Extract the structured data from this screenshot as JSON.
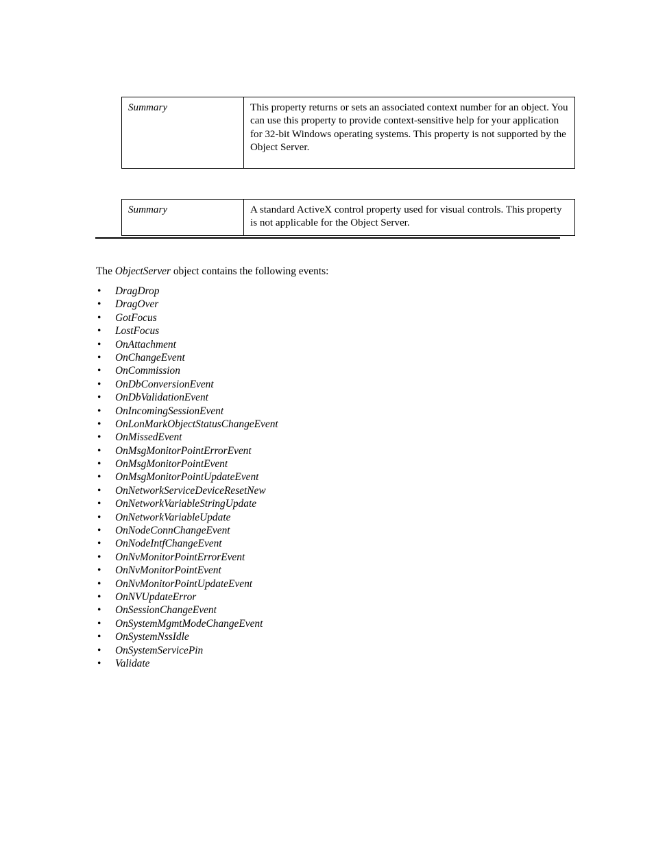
{
  "page": {
    "background_color": "#ffffff",
    "text_color": "#000000"
  },
  "tables": [
    {
      "name": "help-context-id-summary-table",
      "label": "Summary",
      "body": "This property returns or sets an associated context number for an object. You can use this property to provide context-sensitive help for your application for 32-bit Windows operating systems.  This property is not supported by the Object Server."
    },
    {
      "name": "activex-control-property-summary-table",
      "label": "Summary",
      "body": "A standard ActiveX control property used for visual controls. This property is not applicable for the Object Server."
    }
  ],
  "intro": {
    "prefix": "The ",
    "object_name": "ObjectServer",
    "suffix": " object contains the following events:"
  },
  "bullet_glyph": "•",
  "events": [
    "DragDrop",
    "DragOver",
    "GotFocus",
    "LostFocus",
    "OnAttachment",
    "OnChangeEvent",
    "OnCommission",
    "OnDbConversionEvent",
    "OnDbValidationEvent",
    "OnIncomingSessionEvent",
    "OnLonMarkObjectStatusChangeEvent",
    "OnMissedEvent",
    "OnMsgMonitorPointErrorEvent",
    "OnMsgMonitorPointEvent",
    "OnMsgMonitorPointUpdateEvent",
    "OnNetworkServiceDeviceResetNew",
    "OnNetworkVariableStringUpdate",
    "OnNetworkVariableUpdate",
    "OnNodeConnChangeEvent",
    "OnNodeIntfChangeEvent",
    "OnNvMonitorPointErrorEvent",
    "OnNvMonitorPointEvent",
    "OnNvMonitorPointUpdateEvent",
    "OnNVUpdateError",
    "OnSessionChangeEvent",
    "OnSystemMgmtModeChangeEvent",
    "OnSystemNssIdle",
    "OnSystemServicePin",
    "Validate"
  ]
}
